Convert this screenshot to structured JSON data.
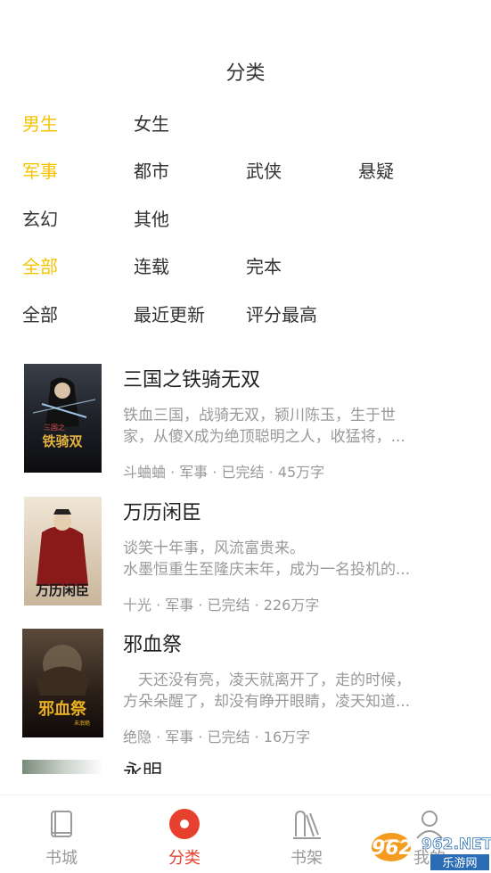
{
  "header": {
    "title": "分类"
  },
  "filters": {
    "gender": {
      "items": [
        "男生",
        "女生"
      ],
      "active": 0
    },
    "category": {
      "items": [
        "军事",
        "都市",
        "武侠",
        "悬疑",
        "玄幻",
        "其他"
      ],
      "active": 0
    },
    "status": {
      "items": [
        "全部",
        "连载",
        "完本"
      ],
      "active": 0
    },
    "sort": {
      "items": [
        "全部",
        "最近更新",
        "评分最高"
      ],
      "active": -1
    }
  },
  "books": [
    {
      "title": "三国之铁骑无双",
      "desc_line1": "铁血三国，战骑无双，颍川陈玉，生于世",
      "desc_line2": "家，从傻X成为绝顶聪明之人，收猛将，...",
      "meta": "斗蛐蛐 · 军事 · 已完结 · 45万字",
      "cover_icon": "book-cover-image"
    },
    {
      "title": "万历闲臣",
      "desc_line1": "谈笑十年事，风流富贵来。",
      "desc_line2": "水墨恒重生至隆庆末年，成为一名投机的...",
      "meta": "十光 · 军事 · 已完结 · 226万字",
      "cover_icon": "book-cover-image"
    },
    {
      "title": "邪血祭",
      "desc_line1": "　天还没有亮，凌天就离开了，走的时候，",
      "desc_line2": "方朵朵醒了，却没有睁开眼睛，凌天知道...",
      "meta": "绝隐 · 军事 · 已完结 · 16万字",
      "cover_icon": "book-cover-image"
    }
  ],
  "partial_book": {
    "title": "永明"
  },
  "tabbar": {
    "items": [
      {
        "label": "书城",
        "icon": "book-icon"
      },
      {
        "label": "分类",
        "icon": "category-icon"
      },
      {
        "label": "书架",
        "icon": "bookshelf-icon"
      },
      {
        "label": "我的",
        "icon": "user-icon"
      }
    ],
    "active": 1
  },
  "watermark": {
    "text": "962.NET",
    "subtext": "乐游网"
  },
  "colors": {
    "accent": "#f5c400",
    "tab_active": "#e8402f",
    "text": "#333333",
    "muted": "#999999"
  }
}
